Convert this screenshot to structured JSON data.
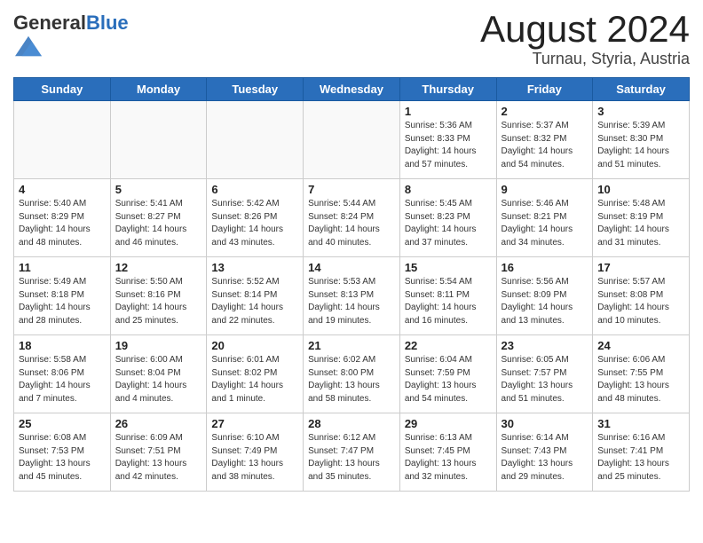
{
  "header": {
    "logo_general": "General",
    "logo_blue": "Blue",
    "month_year": "August 2024",
    "location": "Turnau, Styria, Austria"
  },
  "weekdays": [
    "Sunday",
    "Monday",
    "Tuesday",
    "Wednesday",
    "Thursday",
    "Friday",
    "Saturday"
  ],
  "weeks": [
    [
      {
        "day": "",
        "info": ""
      },
      {
        "day": "",
        "info": ""
      },
      {
        "day": "",
        "info": ""
      },
      {
        "day": "",
        "info": ""
      },
      {
        "day": "1",
        "info": "Sunrise: 5:36 AM\nSunset: 8:33 PM\nDaylight: 14 hours\nand 57 minutes."
      },
      {
        "day": "2",
        "info": "Sunrise: 5:37 AM\nSunset: 8:32 PM\nDaylight: 14 hours\nand 54 minutes."
      },
      {
        "day": "3",
        "info": "Sunrise: 5:39 AM\nSunset: 8:30 PM\nDaylight: 14 hours\nand 51 minutes."
      }
    ],
    [
      {
        "day": "4",
        "info": "Sunrise: 5:40 AM\nSunset: 8:29 PM\nDaylight: 14 hours\nand 48 minutes."
      },
      {
        "day": "5",
        "info": "Sunrise: 5:41 AM\nSunset: 8:27 PM\nDaylight: 14 hours\nand 46 minutes."
      },
      {
        "day": "6",
        "info": "Sunrise: 5:42 AM\nSunset: 8:26 PM\nDaylight: 14 hours\nand 43 minutes."
      },
      {
        "day": "7",
        "info": "Sunrise: 5:44 AM\nSunset: 8:24 PM\nDaylight: 14 hours\nand 40 minutes."
      },
      {
        "day": "8",
        "info": "Sunrise: 5:45 AM\nSunset: 8:23 PM\nDaylight: 14 hours\nand 37 minutes."
      },
      {
        "day": "9",
        "info": "Sunrise: 5:46 AM\nSunset: 8:21 PM\nDaylight: 14 hours\nand 34 minutes."
      },
      {
        "day": "10",
        "info": "Sunrise: 5:48 AM\nSunset: 8:19 PM\nDaylight: 14 hours\nand 31 minutes."
      }
    ],
    [
      {
        "day": "11",
        "info": "Sunrise: 5:49 AM\nSunset: 8:18 PM\nDaylight: 14 hours\nand 28 minutes."
      },
      {
        "day": "12",
        "info": "Sunrise: 5:50 AM\nSunset: 8:16 PM\nDaylight: 14 hours\nand 25 minutes."
      },
      {
        "day": "13",
        "info": "Sunrise: 5:52 AM\nSunset: 8:14 PM\nDaylight: 14 hours\nand 22 minutes."
      },
      {
        "day": "14",
        "info": "Sunrise: 5:53 AM\nSunset: 8:13 PM\nDaylight: 14 hours\nand 19 minutes."
      },
      {
        "day": "15",
        "info": "Sunrise: 5:54 AM\nSunset: 8:11 PM\nDaylight: 14 hours\nand 16 minutes."
      },
      {
        "day": "16",
        "info": "Sunrise: 5:56 AM\nSunset: 8:09 PM\nDaylight: 14 hours\nand 13 minutes."
      },
      {
        "day": "17",
        "info": "Sunrise: 5:57 AM\nSunset: 8:08 PM\nDaylight: 14 hours\nand 10 minutes."
      }
    ],
    [
      {
        "day": "18",
        "info": "Sunrise: 5:58 AM\nSunset: 8:06 PM\nDaylight: 14 hours\nand 7 minutes."
      },
      {
        "day": "19",
        "info": "Sunrise: 6:00 AM\nSunset: 8:04 PM\nDaylight: 14 hours\nand 4 minutes."
      },
      {
        "day": "20",
        "info": "Sunrise: 6:01 AM\nSunset: 8:02 PM\nDaylight: 14 hours\nand 1 minute."
      },
      {
        "day": "21",
        "info": "Sunrise: 6:02 AM\nSunset: 8:00 PM\nDaylight: 13 hours\nand 58 minutes."
      },
      {
        "day": "22",
        "info": "Sunrise: 6:04 AM\nSunset: 7:59 PM\nDaylight: 13 hours\nand 54 minutes."
      },
      {
        "day": "23",
        "info": "Sunrise: 6:05 AM\nSunset: 7:57 PM\nDaylight: 13 hours\nand 51 minutes."
      },
      {
        "day": "24",
        "info": "Sunrise: 6:06 AM\nSunset: 7:55 PM\nDaylight: 13 hours\nand 48 minutes."
      }
    ],
    [
      {
        "day": "25",
        "info": "Sunrise: 6:08 AM\nSunset: 7:53 PM\nDaylight: 13 hours\nand 45 minutes."
      },
      {
        "day": "26",
        "info": "Sunrise: 6:09 AM\nSunset: 7:51 PM\nDaylight: 13 hours\nand 42 minutes."
      },
      {
        "day": "27",
        "info": "Sunrise: 6:10 AM\nSunset: 7:49 PM\nDaylight: 13 hours\nand 38 minutes."
      },
      {
        "day": "28",
        "info": "Sunrise: 6:12 AM\nSunset: 7:47 PM\nDaylight: 13 hours\nand 35 minutes."
      },
      {
        "day": "29",
        "info": "Sunrise: 6:13 AM\nSunset: 7:45 PM\nDaylight: 13 hours\nand 32 minutes."
      },
      {
        "day": "30",
        "info": "Sunrise: 6:14 AM\nSunset: 7:43 PM\nDaylight: 13 hours\nand 29 minutes."
      },
      {
        "day": "31",
        "info": "Sunrise: 6:16 AM\nSunset: 7:41 PM\nDaylight: 13 hours\nand 25 minutes."
      }
    ]
  ]
}
